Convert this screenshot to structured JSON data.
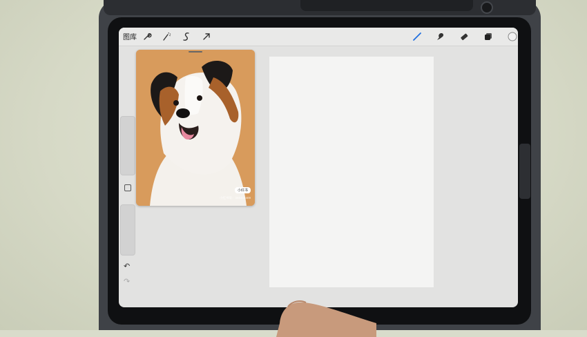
{
  "app": {
    "topbar": {
      "gallery_label": "图库",
      "left_tools": [
        "wrench-icon",
        "magic-wand-icon",
        "selection-icon",
        "transform-arrow-icon"
      ],
      "right_tools": [
        "brush-icon",
        "smudge-icon",
        "eraser-icon",
        "layers-icon",
        "color-swatch"
      ],
      "accent_color": "#1f6fe0"
    },
    "sidebar": {
      "undo_glyph": "↶",
      "redo_glyph": "↷"
    },
    "reference": {
      "badge": "小红书",
      "caption": "小红书号：468403409"
    }
  }
}
